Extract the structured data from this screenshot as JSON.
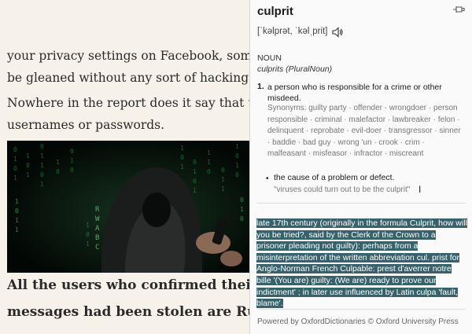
{
  "article": {
    "paragraph1_line1": "your privacy settings on Facebook, some of thi",
    "paragraph1_line2": "be gleaned without any sort of hacking.",
    "paragraph2_line1": "Nowhere in the report does it say that the hac",
    "paragraph2_line2": "usernames or passwords.",
    "caption_line1": "All the users who confirmed their p",
    "caption_line2": "messages had been stolen are Russ"
  },
  "dictionary": {
    "word": "culprit",
    "pin_icon": "pin-icon",
    "pronunciation": "[ˈkəlprət, ˈkəlˌprit]",
    "speaker_icon": "speaker-icon",
    "part_of_speech": "NOUN",
    "plural": "culprits (PluralNoun)",
    "sense1_number": "1.",
    "sense1_text": "a person who is responsible for a crime or other misdeed.",
    "synonyms": "Synonyms: guilty party · offender · wrongdoer · person responsible · criminal · malefactor · lawbreaker · felon · delinquent · reprobate · evil-doer · transgressor · sinner · baddie · bad guy · wrong 'un · crook · crim · malfeasant · misfeasor · infractor · miscreant",
    "sense2_bullet": "•",
    "sense2_text": "the cause of a problem or defect.",
    "sense2_example": "\"viruses could turn out to be the culprit\"",
    "etymology": "late 17th century (originally in the formula Culprit, how will you be tried?, said by the Clerk of the Crown to a prisoner pleading not guilty): perhaps from a misinterpretation of the written abbreviation cul. prist for Anglo-Norman French Culpable: prest d'averrer notre bille '(You are) guilty: (We are) ready to prove our indictment' ; in later use influenced by Latin culpa 'fault, blame'.",
    "powered_by": "Powered by OxfordDictionaries © Oxford University Press"
  },
  "colors": {
    "article_bg": "#f7f2e9",
    "panel_bg": "#fafafa",
    "selection_highlight": "#37626c"
  }
}
